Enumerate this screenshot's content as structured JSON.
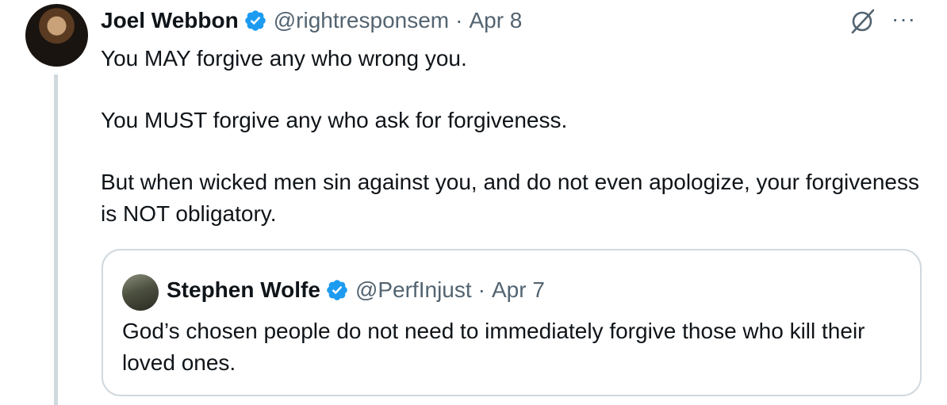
{
  "tweet": {
    "author": {
      "name": "Joel Webbon",
      "handle": "@rightresponsem",
      "date": "Apr 8",
      "separator": "·"
    },
    "more_label": "···",
    "paragraphs": [
      "You MAY forgive any who wrong you.",
      "You MUST forgive any who ask for forgiveness.",
      "But when wicked men sin against you, and do not even apologize, your forgiveness is NOT obligatory."
    ]
  },
  "quote": {
    "author": {
      "name": "Stephen Wolfe",
      "handle": "@PerfInjust",
      "date": "Apr 7",
      "separator": "·"
    },
    "text": "God’s chosen people do not need to immediately forgive those who kill their loved ones."
  },
  "colors": {
    "verified": "#1d9bf0",
    "secondary_text": "#536471",
    "border": "#cfd9de",
    "primary_text": "#0f1419"
  },
  "icons": [
    "verified-badge-icon",
    "grok-icon",
    "more-options-icon"
  ]
}
